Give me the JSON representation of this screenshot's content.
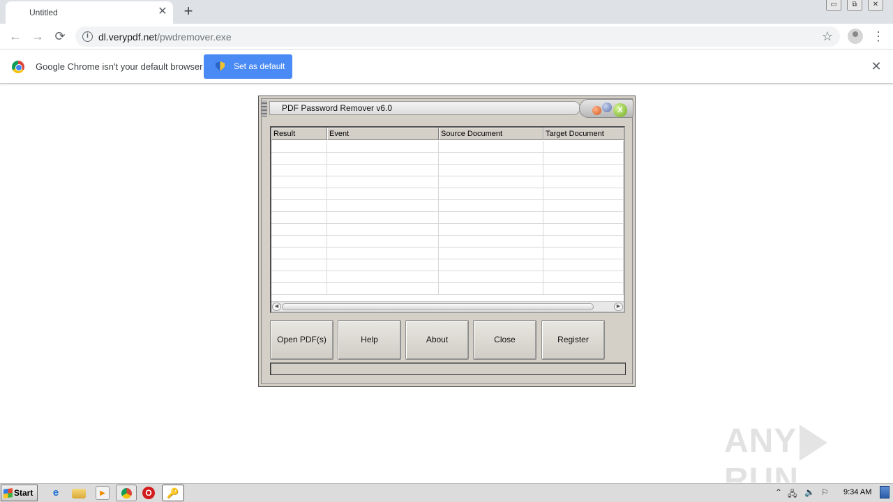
{
  "browser": {
    "tab": {
      "title": "Untitled",
      "close_glyph": "✕"
    },
    "new_tab_glyph": "+",
    "window_controls": [
      "▭",
      "⧉",
      "✕"
    ],
    "nav": {
      "back_glyph": "←",
      "forward_glyph": "→",
      "reload_glyph": "⟳"
    },
    "address": {
      "host": "dl.verypdf.net",
      "path": "/pwdremover.exe",
      "info_glyph": "i"
    },
    "bookmark_glyph": "☆",
    "menu_glyph": "⋮"
  },
  "infobar": {
    "message": "Google Chrome isn't your default browser",
    "button_label": "Set as default",
    "close_glyph": "✕"
  },
  "app": {
    "title": "PDF Password Remover v6.0",
    "close_glyph": "X",
    "columns": [
      {
        "label": "Result"
      },
      {
        "label": "Event"
      },
      {
        "label": "Source Document"
      },
      {
        "label": "Target Document"
      }
    ],
    "buttons": {
      "open": "Open PDF(s)",
      "help": "Help",
      "about": "About",
      "close": "Close",
      "register": "Register"
    },
    "status_text": ""
  },
  "watermark": {
    "left": "ANY",
    "right": "RUN"
  },
  "taskbar": {
    "start_label": "Start",
    "clock": "9:34 AM"
  }
}
